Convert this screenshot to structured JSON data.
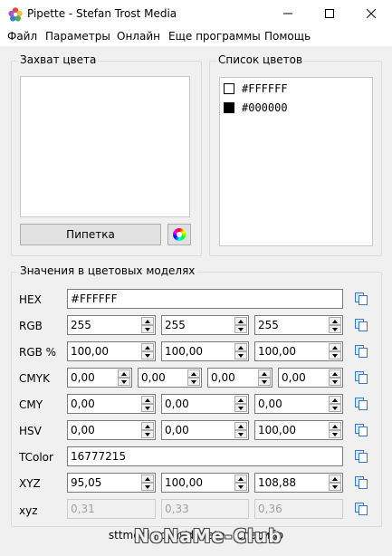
{
  "window": {
    "title": "Pipette - Stefan Trost Media",
    "icon": "pipette-flower-icon"
  },
  "menu": [
    "Файл",
    "Параметры",
    "Онлайн",
    "Еще программы",
    "Помощь"
  ],
  "capture": {
    "group_label": "Захват цвета",
    "pipette_label": "Пипетка",
    "colorwheel_icon": "color-wheel-icon"
  },
  "color_list": {
    "group_label": "Список цветов",
    "items": [
      {
        "code": "#FFFFFF",
        "swatch": "#FFFFFF"
      },
      {
        "code": "#000000",
        "swatch": "#000000"
      }
    ]
  },
  "models": {
    "group_label": "Значения в цветовых моделях",
    "hex": {
      "label": "HEX",
      "value": "#FFFFFF"
    },
    "rgb": {
      "label": "RGB",
      "values": [
        "255",
        "255",
        "255"
      ]
    },
    "rgb_pct": {
      "label": "RGB %",
      "values": [
        "100,00",
        "100,00",
        "100,00"
      ]
    },
    "cmyk": {
      "label": "CMYK",
      "values": [
        "0,00",
        "0,00",
        "0,00",
        "0,00"
      ]
    },
    "cmy": {
      "label": "CMY",
      "values": [
        "0,00",
        "0,00",
        "0,00"
      ]
    },
    "hsv": {
      "label": "HSV",
      "values": [
        "0,00",
        "0,00",
        "100,00"
      ]
    },
    "tcolor": {
      "label": "TColor",
      "value": "16777215"
    },
    "xyz_upper": {
      "label": "XYZ",
      "values": [
        "95,05",
        "100,00",
        "108,88"
      ]
    },
    "xyz_lower": {
      "label": "xyz",
      "values": [
        "0,31",
        "0,33",
        "0,36"
      ]
    }
  },
  "footer": {
    "link_text": "sttmedia.com/donate - Спасибо",
    "watermark": "NoNaMe-Club"
  },
  "colors": {
    "copy_icon_blue": "#3c78c8"
  }
}
